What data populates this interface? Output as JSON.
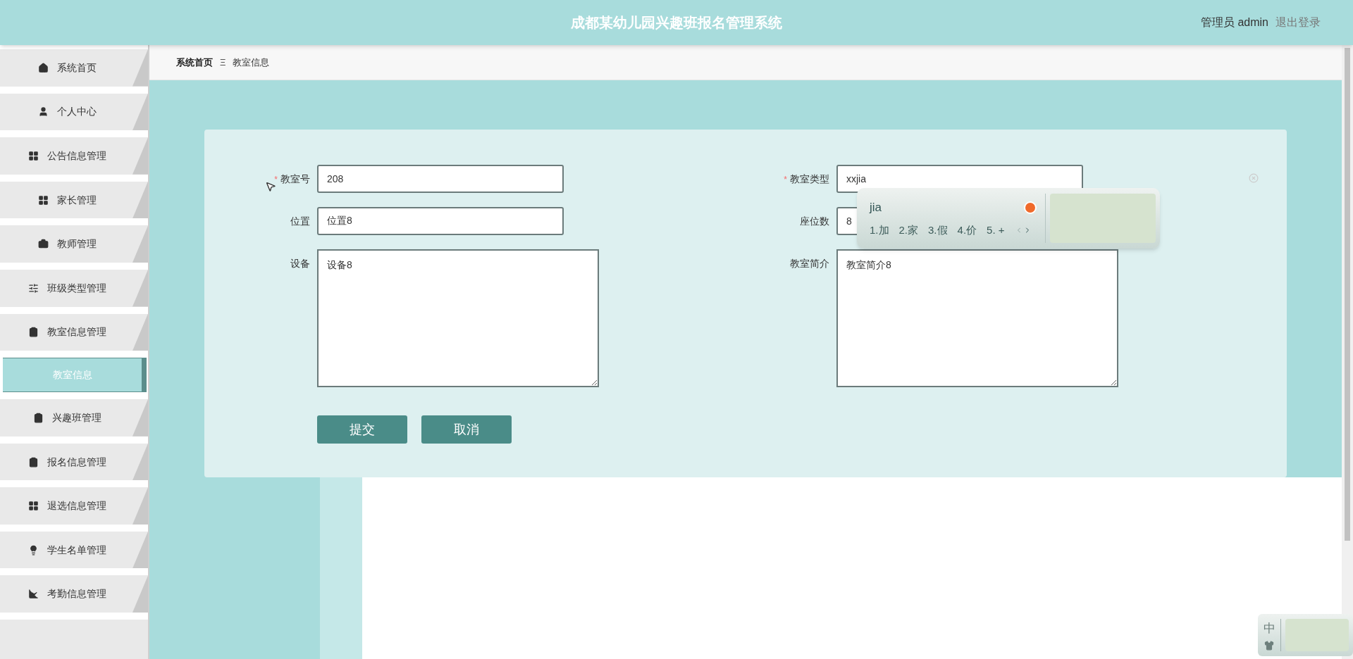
{
  "header": {
    "title": "成都某幼儿园兴趣班报名管理系统",
    "user": "管理员 admin",
    "logout": "退出登录"
  },
  "sidebar": {
    "items": [
      {
        "label": "系统首页",
        "selected": false
      },
      {
        "label": "个人中心",
        "selected": false
      },
      {
        "label": "公告信息管理",
        "selected": false
      },
      {
        "label": "家长管理",
        "selected": false
      },
      {
        "label": "教师管理",
        "selected": false
      },
      {
        "label": "班级类型管理",
        "selected": false
      },
      {
        "label": "教室信息管理",
        "selected": false,
        "expanded": true,
        "children": [
          {
            "label": "教室信息",
            "selected": true
          }
        ]
      },
      {
        "label": "兴趣班管理",
        "selected": false
      },
      {
        "label": "报名信息管理",
        "selected": false
      },
      {
        "label": "退选信息管理",
        "selected": false
      },
      {
        "label": "学生名单管理",
        "selected": false
      },
      {
        "label": "考勤信息管理",
        "selected": false
      }
    ]
  },
  "breadcrumb": {
    "items": [
      "系统首页",
      "教室信息"
    ],
    "separator": "Ξ"
  },
  "form": {
    "fields": [
      {
        "kind": "input",
        "label": "教室号",
        "required": true,
        "value": "208"
      },
      {
        "kind": "input",
        "label": "教室类型",
        "required": true,
        "value": "xxjia"
      },
      {
        "kind": "input",
        "label": "位置",
        "required": false,
        "value": "位置8"
      },
      {
        "kind": "input",
        "label": "座位数",
        "required": false,
        "value": "8"
      },
      {
        "kind": "textarea",
        "label": "设备",
        "required": false,
        "value": "设备8"
      },
      {
        "kind": "textarea",
        "label": "教室简介",
        "required": false,
        "value": "教室简介8"
      }
    ],
    "required_mark": "*",
    "buttons": [
      "提交",
      "取消"
    ]
  },
  "ime": {
    "composition": "jia",
    "candidates": [
      "1.加",
      "2.家",
      "3.假",
      "4.价",
      "5. +"
    ]
  },
  "ime_bar": {
    "mode": "中"
  }
}
